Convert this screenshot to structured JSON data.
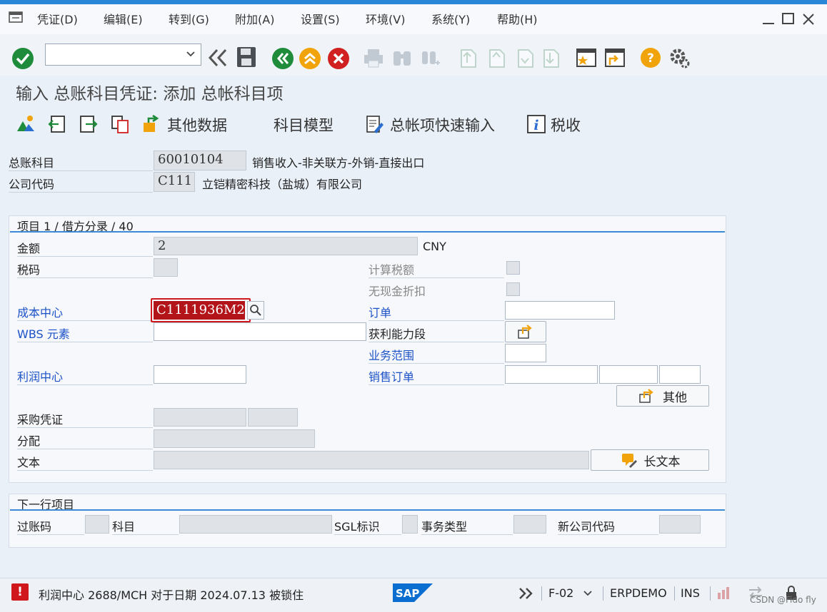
{
  "menu": {
    "items": [
      "凭证(D)",
      "编辑(E)",
      "转到(G)",
      "附加(A)",
      "设置(S)",
      "环境(V)",
      "系统(Y)",
      "帮助(H)"
    ]
  },
  "title": "输入 总账科目凭证: 添加 总帐科目项",
  "app_toolbar": {
    "other_data": "其他数据",
    "account_model": "科目模型",
    "fast_entry": "总帐项快速输入",
    "tax": "税收"
  },
  "header": {
    "gl_label": "总账科目",
    "gl_value": "60010104",
    "gl_desc": "销售收入-非关联方-外销-直接出口",
    "company_label": "公司代码",
    "company_value": "C111",
    "company_desc": "立铠精密科技（盐城）有限公司"
  },
  "item_panel": {
    "title": "项目 1 / 借方分录 / 40",
    "amount_label": "金额",
    "amount_value": "2",
    "currency": "CNY",
    "taxcode_label": "税码",
    "calc_tax_label": "计算税额",
    "no_discount_label": "无现金折扣",
    "costcenter_label": "成本中心",
    "costcenter_value": "C1111936M2",
    "order_label": "订单",
    "wbs_label": "WBS 元素",
    "profitseg_label": "获利能力段",
    "businessarea_label": "业务范围",
    "profitcenter_label": "利润中心",
    "salesorder_label": "销售订单",
    "other_button": "其他",
    "purchase_label": "采购凭证",
    "assignment_label": "分配",
    "text_label": "文本",
    "longtext_button": "长文本"
  },
  "next_panel": {
    "title": "下一行项目",
    "postkey_label": "过账码",
    "account_label": "科目",
    "sgl_label": "SGL标识",
    "txtype_label": "事务类型",
    "newcompany_label": "新公司代码"
  },
  "status": {
    "message": "利润中心 2688/MCH 对于日期 2024.07.13 被锁住",
    "tcode": "F-02",
    "system": "ERPDEMO",
    "mode": "INS",
    "logo": "SAP",
    "watermark": "CSDN @Fido fly"
  },
  "colors": {
    "accent": "#2a87d8",
    "ok_green": "#1e8c3a",
    "exit_orange": "#f0a30a",
    "cancel_red": "#d02020",
    "error_red": "#d0181c",
    "link_blue": "#1c52c7"
  }
}
